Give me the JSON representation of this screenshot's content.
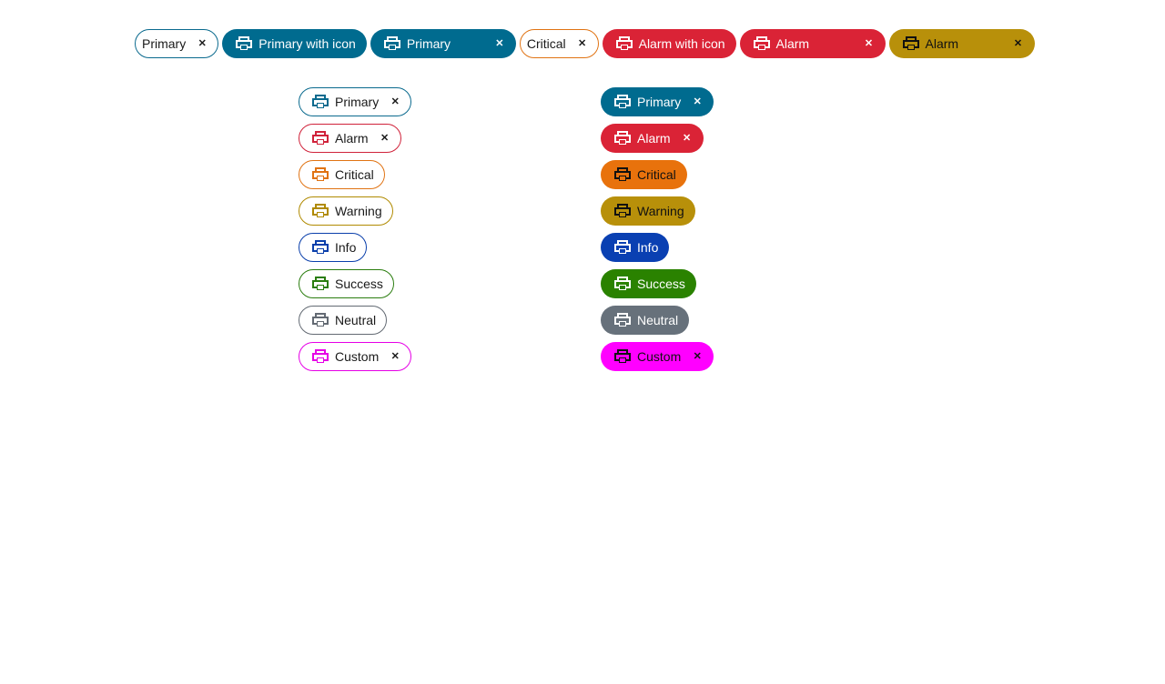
{
  "top_row": [
    {
      "label": "Primary",
      "variant": "o-primary",
      "icon": false,
      "close": true
    },
    {
      "label": "Primary with icon",
      "variant": "f-primary",
      "icon": true,
      "close": false
    },
    {
      "label": "Primary",
      "variant": "f-primary",
      "icon": true,
      "close": true,
      "wide": "w-160"
    },
    {
      "label": "Critical",
      "variant": "o-critical",
      "icon": false,
      "close": true
    },
    {
      "label": "Alarm with icon",
      "variant": "f-alarm",
      "icon": true,
      "close": false
    },
    {
      "label": "Alarm",
      "variant": "f-alarm",
      "icon": true,
      "close": true,
      "wide": "w-160"
    },
    {
      "label": "Alarm",
      "variant": "f-warning",
      "icon": true,
      "close": true,
      "wide": "w-160"
    }
  ],
  "outline_column": [
    {
      "label": "Primary",
      "variant": "o-primary",
      "close": true
    },
    {
      "label": "Alarm",
      "variant": "o-alarm",
      "close": true
    },
    {
      "label": "Critical",
      "variant": "o-critical",
      "close": false
    },
    {
      "label": "Warning",
      "variant": "o-warning",
      "close": false
    },
    {
      "label": "Info",
      "variant": "o-info",
      "close": false
    },
    {
      "label": "Success",
      "variant": "o-success",
      "close": false
    },
    {
      "label": "Neutral",
      "variant": "o-neutral",
      "close": false
    },
    {
      "label": "Custom",
      "variant": "o-custom",
      "close": true
    }
  ],
  "filled_column": [
    {
      "label": "Primary",
      "variant": "f-primary",
      "close": true
    },
    {
      "label": "Alarm",
      "variant": "f-alarm",
      "close": true
    },
    {
      "label": "Critical",
      "variant": "f-critical",
      "close": false
    },
    {
      "label": "Warning",
      "variant": "f-warning",
      "close": false
    },
    {
      "label": "Info",
      "variant": "f-info",
      "close": false
    },
    {
      "label": "Success",
      "variant": "f-success",
      "close": false
    },
    {
      "label": "Neutral",
      "variant": "f-neutral",
      "close": false
    },
    {
      "label": "Custom",
      "variant": "f-custom",
      "close": true
    }
  ],
  "icons": {
    "chip_icon": "printer-icon",
    "close_icon": "close-icon"
  },
  "close_glyph": "✕"
}
